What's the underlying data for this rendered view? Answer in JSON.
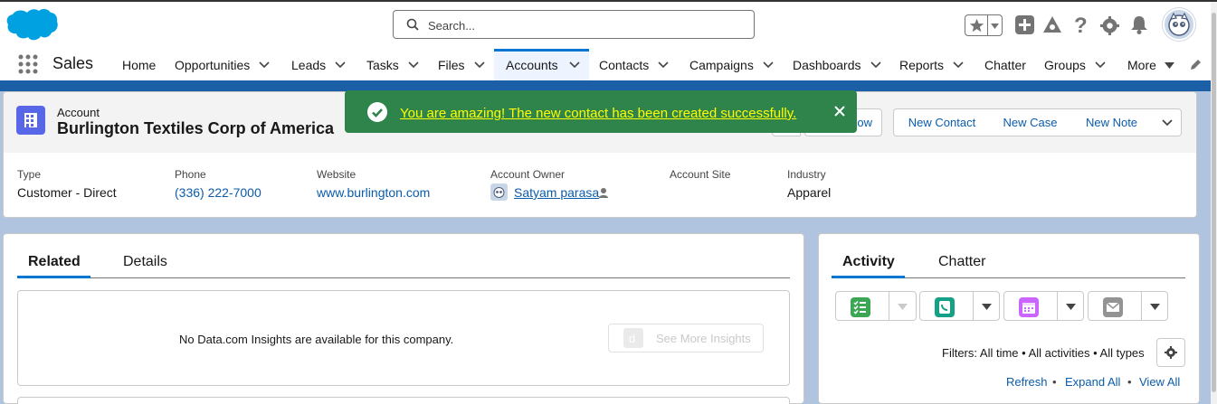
{
  "header": {
    "search_placeholder": "Search...",
    "icons": [
      "favorites-icon",
      "add-icon",
      "trailhead-icon",
      "help-icon",
      "setup-gear-icon",
      "notifications-bell-icon",
      "avatar-icon"
    ]
  },
  "nav": {
    "app_name": "Sales",
    "items": [
      {
        "label": "Home",
        "dropdown": false
      },
      {
        "label": "Opportunities",
        "dropdown": true
      },
      {
        "label": "Leads",
        "dropdown": true
      },
      {
        "label": "Tasks",
        "dropdown": true
      },
      {
        "label": "Files",
        "dropdown": true
      },
      {
        "label": "Accounts",
        "dropdown": true,
        "active": true
      },
      {
        "label": "Contacts",
        "dropdown": true
      },
      {
        "label": "Campaigns",
        "dropdown": true
      },
      {
        "label": "Dashboards",
        "dropdown": true
      },
      {
        "label": "Reports",
        "dropdown": true
      },
      {
        "label": "Chatter",
        "dropdown": false
      },
      {
        "label": "Groups",
        "dropdown": true
      },
      {
        "label": "More",
        "dropdown": true
      }
    ]
  },
  "record": {
    "object_label": "Account",
    "name": "Burlington Textiles Corp of America",
    "actions": {
      "follow": "ow",
      "new_contact": "New Contact",
      "new_case": "New Case",
      "new_note": "New Note"
    },
    "fields": [
      {
        "label": "Type",
        "value": "Customer - Direct",
        "link": false
      },
      {
        "label": "Phone",
        "value": "(336) 222-7000",
        "link": true
      },
      {
        "label": "Website",
        "value": "www.burlington.com",
        "link": true
      },
      {
        "label": "Account Owner",
        "value": "Satyam parasa",
        "link": true
      },
      {
        "label": "Account Site",
        "value": "",
        "link": false
      },
      {
        "label": "Industry",
        "value": "Apparel",
        "link": false
      }
    ]
  },
  "toast": {
    "message": "You are amazing! The new contact has been created successfully.",
    "color": "#2e844a"
  },
  "related": {
    "tabs": [
      "Related",
      "Details"
    ],
    "insights_text": "No Data.com Insights are available for this company.",
    "see_more": "See More Insights"
  },
  "activity": {
    "tabs": [
      "Activity",
      "Chatter"
    ],
    "filters": "Filters: All time • All activities • All types",
    "links": [
      "Refresh",
      "Expand All",
      "View All"
    ],
    "separator": "•"
  },
  "colors": {
    "brand": "#0176d3",
    "link": "#0b5cab",
    "task_icon": "#3ba755",
    "call_icon": "#16a085",
    "event_icon": "#cb65ff",
    "email_icon": "#939393"
  }
}
